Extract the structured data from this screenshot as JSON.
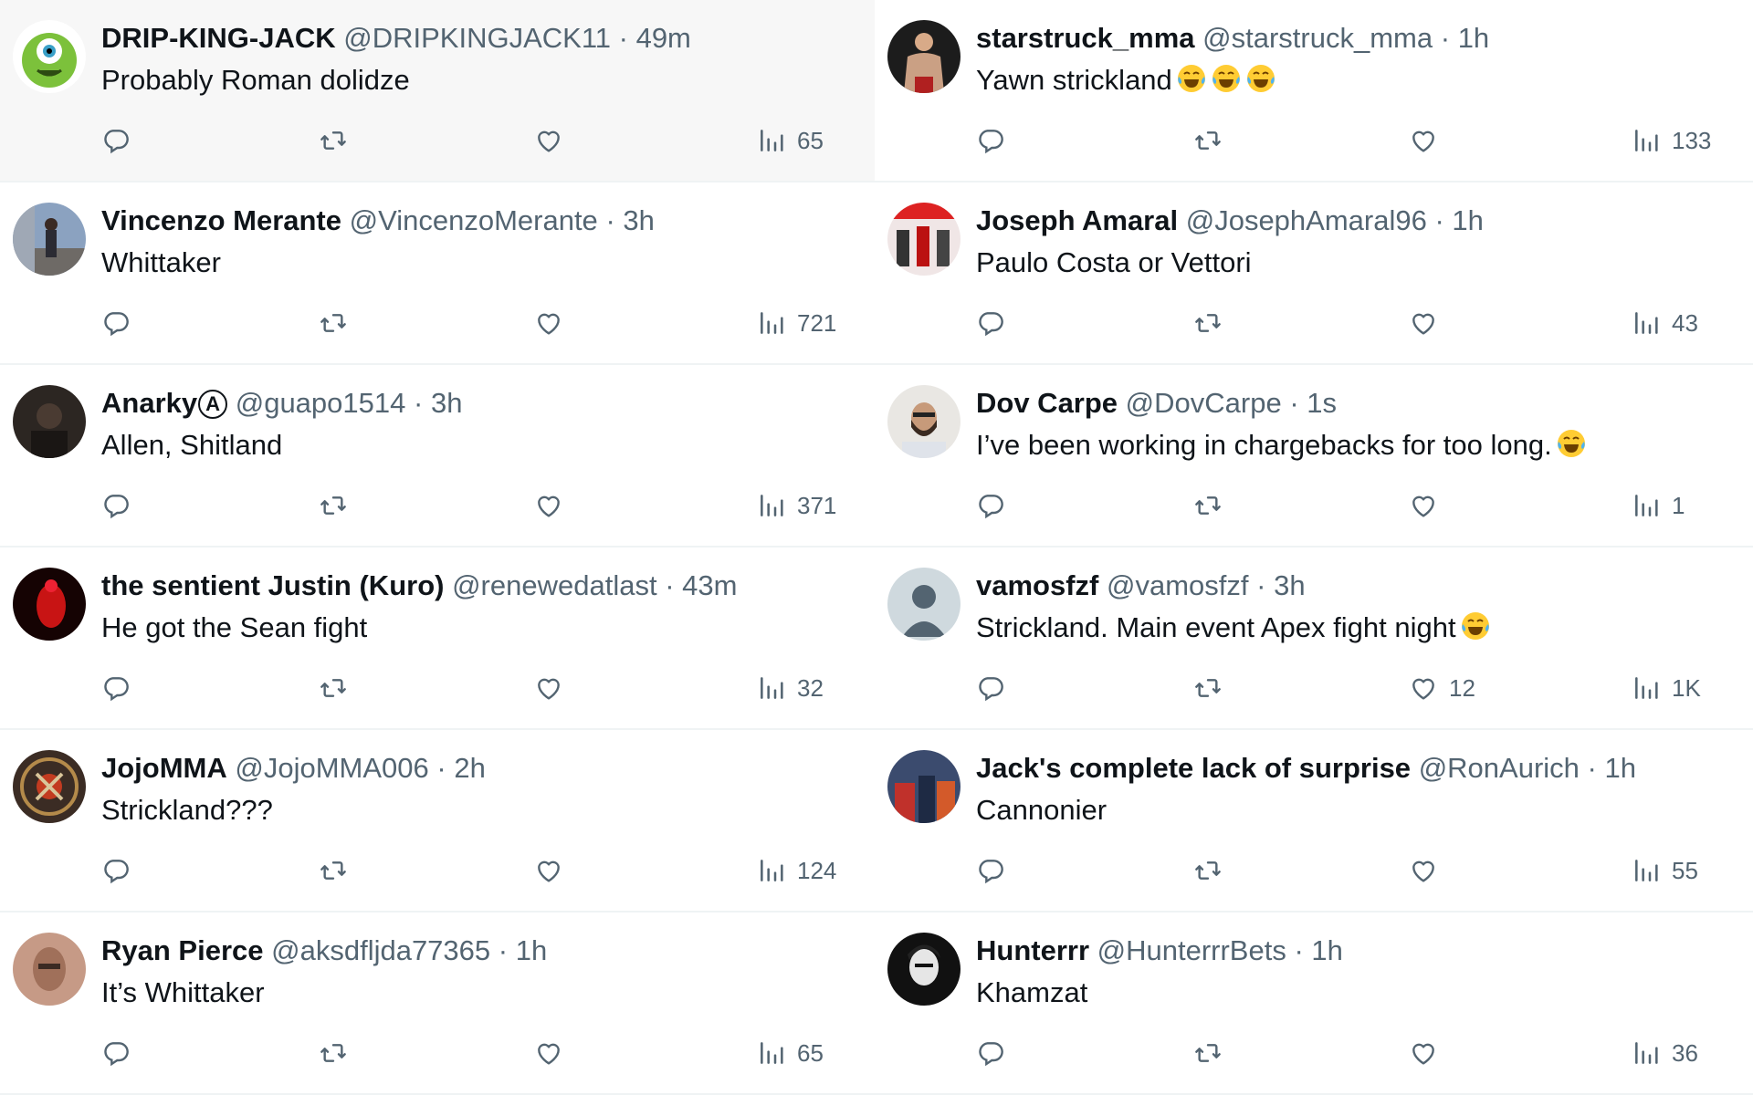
{
  "left_column": [
    {
      "name": "DRIP-KING-JACK",
      "handle": "@DRIPKINGJACK11",
      "time": "49m",
      "text": "Probably Roman dolidze",
      "views": "65",
      "likes": "",
      "avatar": "green-monster",
      "highlight": true
    },
    {
      "name": "Vincenzo Merante",
      "handle": "@VincenzoMerante",
      "time": "3h",
      "text": "Whittaker",
      "views": "721",
      "likes": "",
      "avatar": "person-outdoor"
    },
    {
      "name": "Anarky",
      "badge": "A",
      "handle": "@guapo1514",
      "time": "3h",
      "text": "Allen, Shitland",
      "views": "371",
      "likes": "",
      "avatar": "dark-person"
    },
    {
      "name": "the sentient Justin (Kuro)",
      "handle": "@renewedatlast",
      "time": "43m",
      "text": "He got the Sean fight",
      "views": "32",
      "likes": "",
      "avatar": "red-figure"
    },
    {
      "name": "JojoMMA",
      "handle": "@JojoMMA006",
      "time": "2h",
      "text": "Strickland???",
      "views": "124",
      "likes": "",
      "avatar": "emblem"
    },
    {
      "name": "Ryan Pierce",
      "handle": "@aksdfljda77365",
      "time": "1h",
      "text": "It’s Whittaker",
      "views": "65",
      "likes": "",
      "avatar": "face"
    }
  ],
  "right_column": [
    {
      "name": "starstruck_mma",
      "handle": "@starstruck_mma",
      "time": "1h",
      "text": "Yawn strickland",
      "emoji_count": 3,
      "views": "133",
      "likes": "",
      "avatar": "fighter"
    },
    {
      "name": "Joseph Amaral",
      "handle": "@JosephAmaral96",
      "time": "1h",
      "text": "Paulo Costa or Vettori",
      "views": "43",
      "likes": "",
      "avatar": "group-red"
    },
    {
      "name": "Dov Carpe",
      "handle": "@DovCarpe",
      "time": "1s",
      "text": "I’ve been working in chargebacks for too long.",
      "emoji_count": 1,
      "views": "1",
      "likes": "",
      "avatar": "bearded-man"
    },
    {
      "name": "vamosfzf",
      "handle": "@vamosfzf",
      "time": "3h",
      "text": "Strickland. Main event Apex fight night",
      "emoji_count": 1,
      "views": "1K",
      "likes": "12",
      "avatar": "default"
    },
    {
      "name": "Jack's complete lack of surprise",
      "handle": "@RonAurich",
      "time": "1h",
      "text": "Cannonier",
      "views": "55",
      "likes": "",
      "avatar": "group-blue"
    },
    {
      "name": "Hunterrr",
      "handle": "@HunterrrBets",
      "time": "1h",
      "text": "Khamzat",
      "views": "36",
      "likes": "",
      "avatar": "bw-man"
    }
  ],
  "separator": "·",
  "colors": {
    "muted": "#536471",
    "text": "#0f1419",
    "divider": "#eff3f4",
    "highlight_bg": "#f7f7f7"
  },
  "icons": {
    "reply": "reply-icon",
    "retweet": "retweet-icon",
    "like": "like-icon",
    "views": "views-icon",
    "emoji": "tears-of-joy-emoji"
  }
}
